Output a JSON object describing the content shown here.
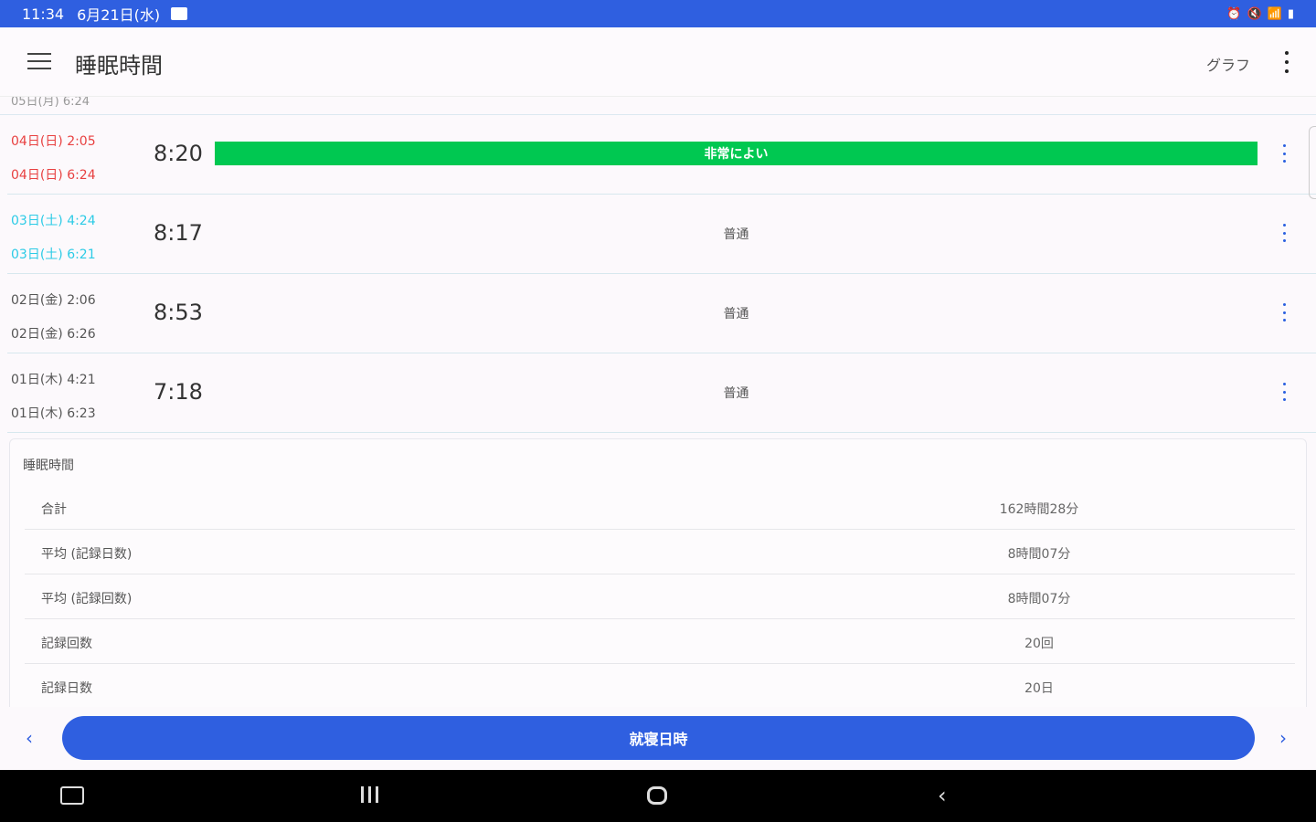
{
  "status_bar": {
    "time": "11:34",
    "date": "6月21日(水)"
  },
  "app_bar": {
    "title": "睡眠時間",
    "graph_label": "グラフ"
  },
  "partial_row_text": "05日(月) 6:24",
  "records": [
    {
      "start": "04日(日) 2:05",
      "end": "04日(日) 6:24",
      "duration": "8:20",
      "quality": "非常によい",
      "highlight": true,
      "day_color": "#e84141"
    },
    {
      "start": "03日(土) 4:24",
      "end": "03日(土) 6:21",
      "duration": "8:17",
      "quality": "普通",
      "highlight": false,
      "day_color": "#2ccbe6"
    },
    {
      "start": "02日(金) 2:06",
      "end": "02日(金) 6:26",
      "duration": "8:53",
      "quality": "普通",
      "highlight": false,
      "day_color": "#555555"
    },
    {
      "start": "01日(木) 4:21",
      "end": "01日(木) 6:23",
      "duration": "7:18",
      "quality": "普通",
      "highlight": false,
      "day_color": "#555555"
    }
  ],
  "summary": {
    "title": "睡眠時間",
    "rows": [
      {
        "label": "合計",
        "value": "162時間28分"
      },
      {
        "label": "平均 (記録日数)",
        "value": "8時間07分"
      },
      {
        "label": "平均 (記録回数)",
        "value": "8時間07分"
      },
      {
        "label": "記録回数",
        "value": "20回"
      },
      {
        "label": "記録日数",
        "value": "20日"
      }
    ]
  },
  "bottom": {
    "main_button": "就寝日時",
    "prev": "‹",
    "next": "›"
  },
  "colors": {
    "primary": "#2f5fe0",
    "good_bar": "#00c851"
  }
}
